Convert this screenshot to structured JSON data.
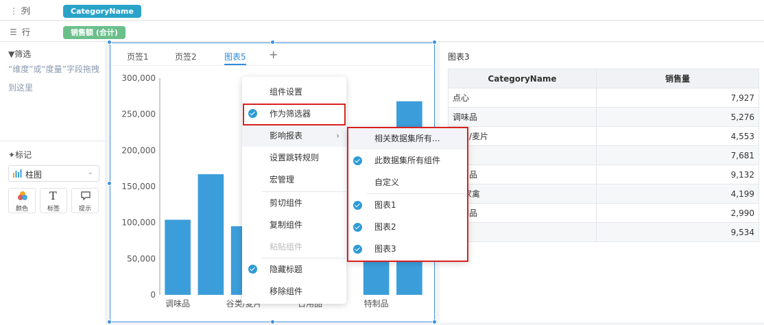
{
  "shelves": {
    "columns_label": "列",
    "columns_pill": "CategoryName",
    "rows_label": "行",
    "rows_pill": "销售额 (合计)"
  },
  "colors": {
    "accent": "#2e9bd5",
    "columns_pill": "#2aa3c9",
    "rows_pill": "#6bbf8b",
    "bar": "#3b9edb",
    "selection": "#3d8fe0",
    "highlight_box": "#d9201e"
  },
  "filter": {
    "title": "筛选",
    "hint": "“维度”或“度量”字段拖拽到这里"
  },
  "marks": {
    "title": "标记",
    "chart_type": "柱图",
    "buttons": [
      {
        "label": "颜色",
        "icon": "color-icon"
      },
      {
        "label": "标签",
        "icon": "text-icon"
      },
      {
        "label": "提示",
        "icon": "tooltip-icon"
      }
    ]
  },
  "chart_widget": {
    "tabs": [
      "页签1",
      "页签2",
      "图表5"
    ],
    "active_tab": "图表5",
    "add_tab": "+"
  },
  "chart_data": {
    "type": "bar",
    "categories": [
      "调味品",
      "",
      "谷类/麦片",
      "",
      "日用品",
      "",
      "特制品",
      ""
    ],
    "x_tick_labels": [
      "调味品",
      "谷类/麦片",
      "日用品",
      "特制品"
    ],
    "values": [
      104000,
      167000,
      95000,
      0,
      0,
      0,
      105000,
      268000
    ],
    "y_ticks": [
      "0",
      "50,000",
      "100,000",
      "150,000",
      "200,000",
      "250,000",
      "300,000"
    ],
    "ylim": [
      0,
      300000
    ],
    "title": "",
    "xlabel": "",
    "ylabel": ""
  },
  "table_widget": {
    "title": "图表3",
    "headers": [
      "CategoryName",
      "销售量"
    ],
    "rows": [
      [
        "点心",
        "7,927"
      ],
      [
        "调味品",
        "5,276"
      ],
      [
        "谷类/麦片",
        "4,553"
      ],
      [
        "",
        "7,681"
      ],
      [
        "日用品",
        "9,132"
      ],
      [
        "肉/家禽",
        "4,199"
      ],
      [
        "特制品",
        "2,990"
      ],
      [
        "",
        "9,534"
      ]
    ]
  },
  "context_menu": {
    "items": [
      {
        "label": "组件设置",
        "checked": false,
        "disabled": false
      },
      {
        "label": "作为筛选器",
        "checked": true,
        "disabled": false
      },
      {
        "label": "影响报表",
        "checked": false,
        "disabled": false,
        "submenu": true
      },
      {
        "label": "设置跳转规则",
        "checked": false,
        "disabled": false
      },
      {
        "label": "宏管理",
        "checked": false,
        "disabled": false
      },
      {
        "label": "剪切组件",
        "checked": false,
        "disabled": false
      },
      {
        "label": "复制组件",
        "checked": false,
        "disabled": false
      },
      {
        "label": "粘贴组件",
        "checked": false,
        "disabled": true
      },
      {
        "label": "隐藏标题",
        "checked": true,
        "disabled": false
      },
      {
        "label": "移除组件",
        "checked": false,
        "disabled": false
      }
    ]
  },
  "submenu": {
    "items": [
      {
        "label": "相关数据集所有...",
        "checked": false
      },
      {
        "label": "此数据集所有组件",
        "checked": true
      },
      {
        "label": "自定义",
        "checked": false
      },
      {
        "label": "图表1",
        "checked": true
      },
      {
        "label": "图表2",
        "checked": true
      },
      {
        "label": "图表3",
        "checked": true
      }
    ]
  }
}
